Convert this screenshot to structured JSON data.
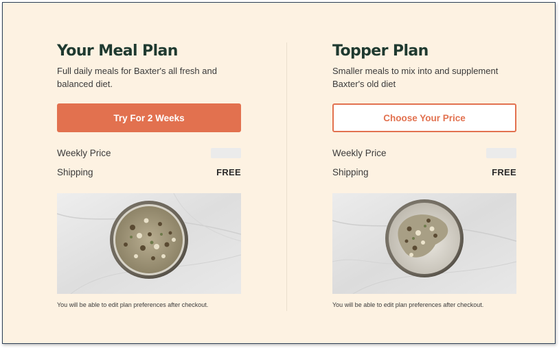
{
  "plans": [
    {
      "title": "Your Meal Plan",
      "description": "Full daily meals for Baxter's all fresh and balanced diet.",
      "button_label": "Try For 2 Weeks",
      "weekly_price_label": "Weekly Price",
      "shipping_label": "Shipping",
      "shipping_value": "FREE",
      "note": "You will be able to edit plan preferences after checkout."
    },
    {
      "title": "Topper Plan",
      "description": "Smaller meals to mix into and supplement Baxter's old diet",
      "button_label": "Choose Your Price",
      "weekly_price_label": "Weekly Price",
      "shipping_label": "Shipping",
      "shipping_value": "FREE",
      "note": "You will be able to edit plan preferences after checkout."
    }
  ],
  "colors": {
    "background": "#fdf2e2",
    "accent": "#e2714f",
    "title": "#1f3a30"
  }
}
